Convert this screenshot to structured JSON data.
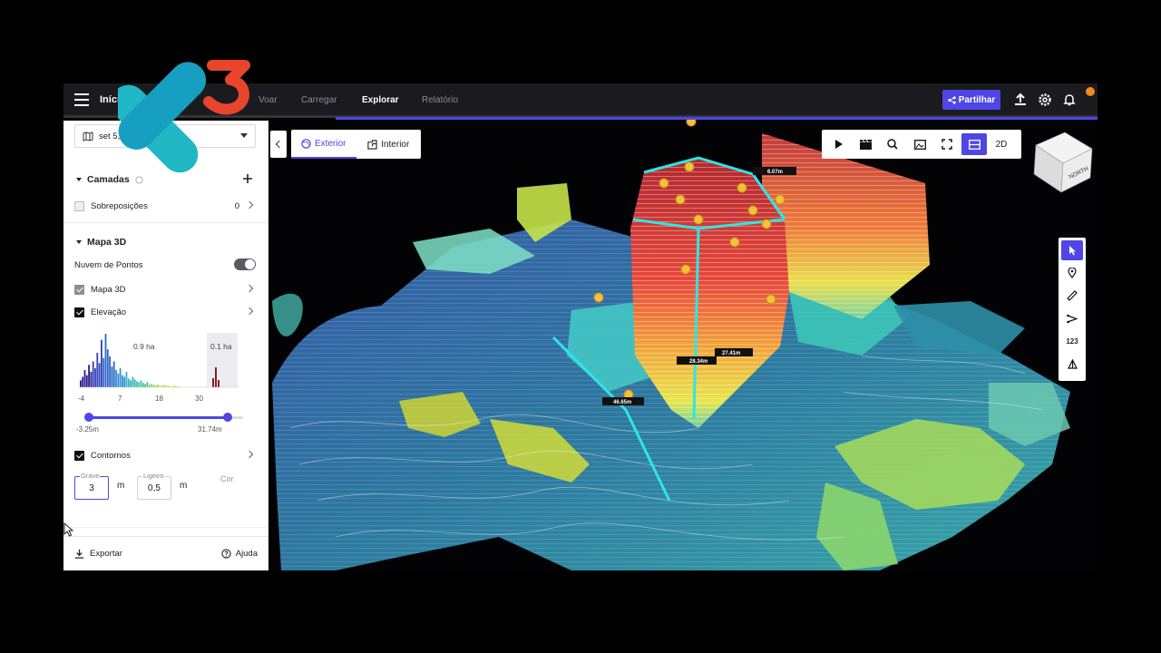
{
  "topbar": {
    "breadcrumb_home": "Início",
    "breadcrumb_sep": "/",
    "tabs": [
      {
        "label": "Voar",
        "active": false
      },
      {
        "label": "Carregar",
        "active": false
      },
      {
        "label": "Explorar",
        "active": true
      },
      {
        "label": "Relatório",
        "active": false
      }
    ],
    "share_label": "Partilhar"
  },
  "sidebar": {
    "date_value": "set 5, 20",
    "layers_title": "Camadas",
    "overlays_label": "Sobreposições",
    "overlays_count": "0",
    "map3d_title": "Mapa 3D",
    "point_cloud_label": "Nuvem de Pontos",
    "point_cloud_on": false,
    "map3d_label": "Mapa 3D",
    "elevation_label": "Elevação",
    "histogram": {
      "area_label_left": "0.9 ha",
      "area_label_right": "0.1 ha",
      "ticks": [
        "-4",
        "7",
        "18",
        "30"
      ],
      "range_min": "-3.25m",
      "range_max": "31.74m",
      "selected_fraction": [
        0.0,
        0.9
      ]
    },
    "contours_label": "Contornos",
    "heavy_label": "Grave",
    "heavy_value": "3",
    "light_label": "Ligeiro",
    "light_value": "0,5",
    "unit": "m",
    "color_label": "Cor",
    "export_label": "Exportar",
    "help_label": "Ajuda"
  },
  "map": {
    "view_tabs": [
      {
        "label": "Exterior",
        "active": true
      },
      {
        "label": "Interior",
        "active": false
      }
    ],
    "toolbar_2d_label": "2D",
    "measure_label": "123",
    "compass_label": "NORTH",
    "measurements": [
      "6.07m",
      "27.41m",
      "28.34m",
      "46.65m"
    ]
  },
  "colors": {
    "accent": "#4f46e5",
    "notification": "#f08a1e",
    "logo_teal": "#1fb8c4",
    "logo_red": "#e8452c"
  }
}
